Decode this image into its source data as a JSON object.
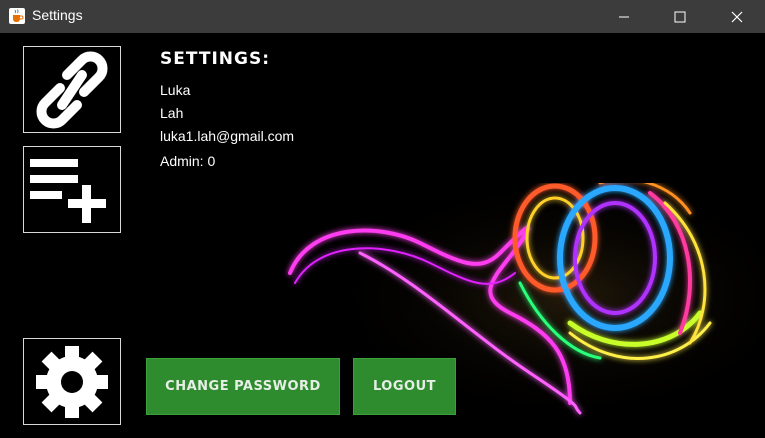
{
  "window": {
    "title": "Settings"
  },
  "icons": {
    "app": "java-cup-icon",
    "link": "link-icon",
    "playlist": "playlist-add-icon",
    "settings": "gear-icon"
  },
  "content": {
    "heading": "SETTINGS:",
    "first_name": "Luka",
    "last_name": "Lah",
    "email": "luka1.lah@gmail.com",
    "admin": "Admin: 0"
  },
  "buttons": {
    "change_password": "CHANGE PASSWORD",
    "logout": "LOGOUT"
  },
  "colors": {
    "titlebar": "#3c3c3c",
    "button_green": "#2e8b2e",
    "background": "#000000"
  }
}
